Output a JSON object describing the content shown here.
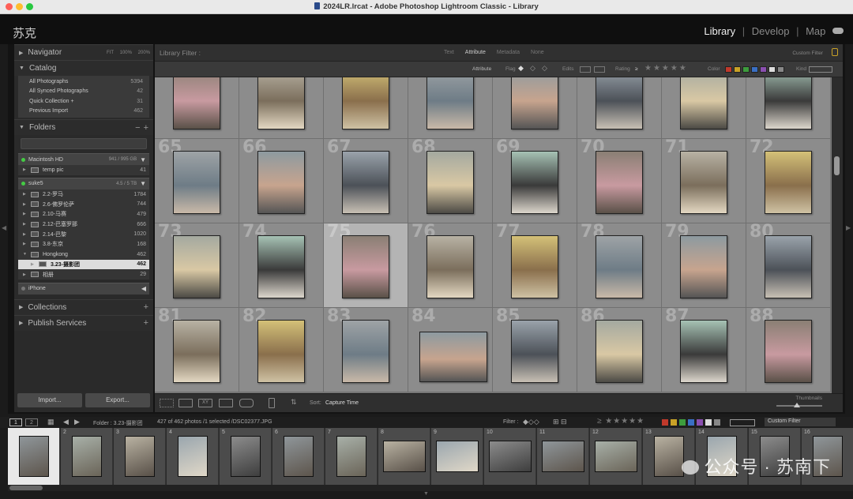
{
  "window": {
    "title": "2024LR.lrcat - Adobe Photoshop Lightroom Classic - Library"
  },
  "identity": "苏克",
  "modules": [
    {
      "label": "Library",
      "active": true
    },
    {
      "label": "Develop",
      "active": false
    },
    {
      "label": "Map",
      "active": false
    }
  ],
  "left": {
    "navigator": {
      "label": "Navigator",
      "options": [
        "FIT",
        "100%",
        "200%"
      ]
    },
    "catalog": {
      "label": "Catalog",
      "items": [
        {
          "label": "All Photographs",
          "count": "5394"
        },
        {
          "label": "All Synced Photographs",
          "count": "42"
        },
        {
          "label": "Quick Collection +",
          "count": "31"
        },
        {
          "label": "Previous Import",
          "count": "462"
        }
      ]
    },
    "folders": {
      "label": "Folders",
      "volume1": {
        "label": "Macintosh HD",
        "size": "941 / 995 GB"
      },
      "vol1_items": [
        {
          "label": "temp pic",
          "count": "41"
        }
      ],
      "volume2": {
        "label": "suke5",
        "size": "4.5 / 5 TB"
      },
      "vol2_items": [
        {
          "label": "2.2-罗马",
          "count": "1784"
        },
        {
          "label": "2.6-佛罗伦萨",
          "count": "744"
        },
        {
          "label": "2.10-马赛",
          "count": "479"
        },
        {
          "label": "2.12-巴塞罗那",
          "count": "666"
        },
        {
          "label": "2.14-巴黎",
          "count": "1020"
        },
        {
          "label": "3.8-东京",
          "count": "168"
        },
        {
          "label": "Hongkong",
          "count": "462"
        },
        {
          "label": "3.23-摄影团",
          "count": "462"
        },
        {
          "label": "相册",
          "count": "29"
        }
      ],
      "volume3": {
        "label": "iPhone"
      }
    },
    "collections": "Collections",
    "publish": "Publish Services",
    "import": "Import...",
    "export": "Export..."
  },
  "filter": {
    "title": "Library Filter :",
    "tabs": [
      "Text",
      "Attribute",
      "Metadata",
      "None"
    ],
    "active_tab": "Attribute",
    "preset": "Custom Filter",
    "attr": {
      "attribute": "Attribute",
      "flag": "Flag",
      "edits": "Edits",
      "rating": "Rating",
      "rating_op": "≥",
      "color": "Color",
      "kind": "Kind"
    }
  },
  "grid": {
    "cells": [
      {
        "n": ""
      },
      {
        "n": ""
      },
      {
        "n": ""
      },
      {
        "n": ""
      },
      {
        "n": ""
      },
      {
        "n": ""
      },
      {
        "n": ""
      },
      {
        "n": ""
      },
      {
        "n": "65"
      },
      {
        "n": "66"
      },
      {
        "n": "67"
      },
      {
        "n": "68"
      },
      {
        "n": "69"
      },
      {
        "n": "70"
      },
      {
        "n": "71"
      },
      {
        "n": "72"
      },
      {
        "n": "73"
      },
      {
        "n": "74"
      },
      {
        "n": "75"
      },
      {
        "n": "76"
      },
      {
        "n": "77"
      },
      {
        "n": "78"
      },
      {
        "n": "79"
      },
      {
        "n": "80"
      },
      {
        "n": "81"
      },
      {
        "n": "82"
      },
      {
        "n": "83"
      },
      {
        "n": "84"
      },
      {
        "n": "85"
      },
      {
        "n": "86"
      },
      {
        "n": "87"
      },
      {
        "n": "88"
      }
    ],
    "selected_index": 18
  },
  "toolbar": {
    "sort_label": "Sort:",
    "sort_value": "Capture Time",
    "thumbs_label": "Thumbnails"
  },
  "filmstrip_bar": {
    "views": [
      "1",
      "2"
    ],
    "folder": "Folder : 3.23-摄影团",
    "status": "427 of 462 photos /1 selected /DSC02377.JPG",
    "filter_label": "Filter :",
    "preset": "Custom Filter"
  },
  "filmstrip": {
    "items": [
      "",
      "2",
      "3",
      "4",
      "5",
      "6",
      "7",
      "8",
      "9",
      "10",
      "11",
      "12",
      "13",
      "14",
      "15",
      "16"
    ],
    "selected_index": 0
  },
  "watermark": "公众号 · 苏南下",
  "colors": {
    "accent": "#dcdcdc",
    "flag_red": "#c0392b",
    "label_colors": [
      "#c0392b",
      "#c9a227",
      "#3d9c3d",
      "#3a6fc4",
      "#8a4fb0",
      "#dddddd",
      "#888888"
    ]
  }
}
